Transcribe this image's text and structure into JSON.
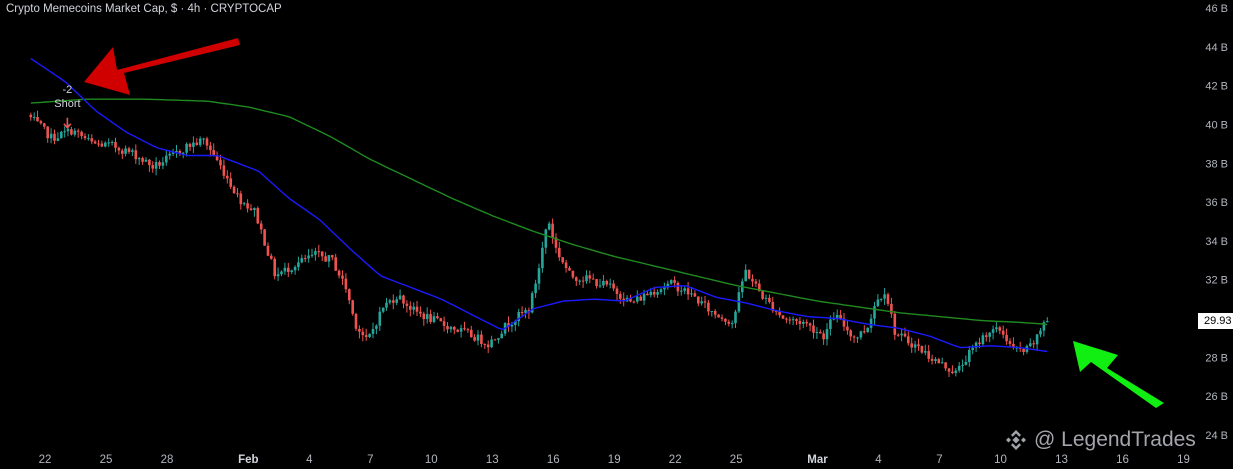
{
  "chart_data": {
    "type": "candlestick",
    "title": "Crypto Memecoins Market Cap, $ · 4h · CRYPTOCAP",
    "unit": "B",
    "y_ticks": [
      24,
      26,
      28,
      30,
      32,
      34,
      36,
      38,
      40,
      42,
      44,
      46
    ],
    "y_tick_labels": [
      "24 B",
      "26 B",
      "28 B",
      "30 B",
      "32 B",
      "34 B",
      "36 B",
      "38 B",
      "40 B",
      "42 B",
      "44 B",
      "46 B"
    ],
    "ylim": [
      23.6,
      46.3
    ],
    "x_ticks": [
      "22",
      "25",
      "28",
      "Feb",
      "4",
      "7",
      "10",
      "13",
      "16",
      "19",
      "22",
      "25",
      "Mar",
      "4",
      "7",
      "10",
      "13",
      "16",
      "19"
    ],
    "x_tick_days": [
      0,
      3,
      6,
      10,
      13,
      16,
      19,
      22,
      25,
      28,
      31,
      34,
      38,
      41,
      44,
      47,
      50,
      53,
      56
    ],
    "x_bold_labels": [
      "Feb",
      "Mar"
    ],
    "last_price_label": "29.93",
    "last_price": 29.93,
    "grid": false,
    "colors": {
      "up": "#26a69a",
      "down": "#ef5350",
      "ma_fast": "#1a1aff",
      "ma_slow": "#1f8a1f",
      "background": "#000000"
    },
    "ma_fast": {
      "days": [
        -0.7,
        1,
        2.5,
        4,
        5.5,
        7,
        8.5,
        10.5,
        12,
        13.5,
        15,
        16.5,
        18,
        19.5,
        21,
        22.5,
        24,
        25.5,
        27,
        28.5,
        30,
        31.5,
        33,
        34.5,
        36,
        37.5,
        39,
        40.5,
        42,
        43.5,
        45,
        46.5,
        48,
        49.3
      ],
      "values": [
        43.4,
        42.2,
        40.7,
        39.6,
        38.8,
        38.4,
        38.4,
        37.6,
        36.2,
        35.1,
        33.6,
        32.2,
        31.6,
        31.0,
        30.2,
        29.4,
        30.5,
        30.9,
        31.0,
        30.9,
        31.6,
        31.7,
        31.1,
        30.8,
        30.4,
        30.1,
        30.0,
        29.7,
        29.5,
        29.1,
        28.5,
        28.6,
        28.5,
        28.3
      ]
    },
    "ma_slow": {
      "days": [
        -0.7,
        2,
        5,
        8,
        10,
        12,
        14,
        16,
        18,
        20,
        22,
        24,
        26,
        28,
        30,
        32,
        34,
        36,
        38,
        40,
        42,
        44,
        46,
        48,
        49.3
      ],
      "values": [
        41.1,
        41.3,
        41.3,
        41.2,
        40.9,
        40.4,
        39.4,
        38.2,
        37.2,
        36.2,
        35.3,
        34.5,
        33.8,
        33.2,
        32.7,
        32.2,
        31.7,
        31.3,
        30.9,
        30.6,
        30.3,
        30.1,
        29.9,
        29.8,
        29.7
      ]
    },
    "anchors": {
      "days": [
        -0.7,
        0.5,
        1.5,
        2.5,
        3.5,
        4.5,
        5.5,
        6.3,
        7.2,
        8.0,
        9.0,
        9.7,
        10.5,
        11.5,
        12.5,
        13.5,
        14.3,
        15.0,
        15.4,
        16.0,
        16.8,
        17.5,
        18.3,
        19.5,
        21.0,
        22.0,
        23.0,
        24.0,
        24.5,
        24.9,
        25.3,
        26.0,
        27.0,
        28.0,
        29.0,
        30.0,
        31.0,
        32.0,
        33.0,
        34.0,
        34.6,
        35.5,
        36.5,
        37.5,
        38.5,
        39.0,
        40.0,
        40.6,
        41.0,
        41.5,
        42.0,
        43.0,
        44.0,
        45.0,
        45.5,
        46.5,
        47.2,
        47.8,
        48.4,
        49.0,
        49.3
      ],
      "values": [
        40.5,
        39.3,
        39.7,
        39.0,
        38.9,
        38.5,
        37.8,
        38.3,
        38.9,
        39.2,
        37.5,
        36.2,
        35.5,
        32.2,
        32.8,
        33.3,
        33.0,
        31.5,
        29.8,
        28.8,
        30.6,
        31.2,
        30.4,
        29.8,
        29.2,
        28.7,
        29.8,
        30.5,
        32.8,
        35.2,
        33.6,
        32.2,
        32.0,
        31.6,
        30.8,
        31.4,
        31.8,
        31.2,
        30.3,
        29.8,
        32.5,
        31.1,
        30.0,
        29.8,
        29.1,
        30.2,
        29.0,
        29.5,
        30.8,
        31.5,
        29.2,
        28.6,
        27.8,
        27.2,
        28.0,
        29.3,
        29.4,
        28.4,
        28.3,
        29.0,
        29.9
      ]
    },
    "annotations": [
      {
        "label": "-2",
        "sublabel": "Short",
        "day": 1.1,
        "value": 38.8
      }
    ]
  },
  "watermark": {
    "text": "@ LegendTrades"
  }
}
